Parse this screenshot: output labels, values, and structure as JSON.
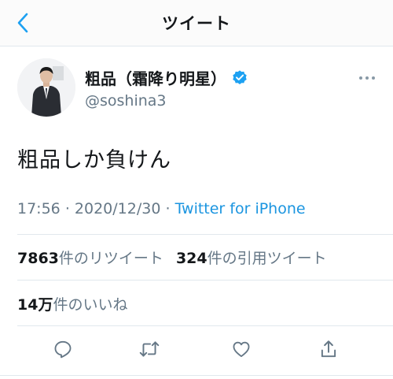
{
  "nav": {
    "title": "ツイート",
    "back_icon": "chevron-left-icon"
  },
  "user": {
    "name": "粗品（霜降り明星）",
    "handle": "@soshina3",
    "verified": true
  },
  "tweet": {
    "text": "粗品しか負けん",
    "time": "17:56",
    "date": "2020/12/30",
    "separator": "·",
    "source": "Twitter for iPhone"
  },
  "stats": {
    "retweets_count": "7863",
    "retweets_label": "件のリツイート",
    "quotes_count": "324",
    "quotes_label": "件の引用ツイート",
    "likes_count": "14万",
    "likes_label": "件のいいね"
  },
  "actions": [
    "reply-icon",
    "retweet-icon",
    "like-icon",
    "share-icon"
  ],
  "colors": {
    "link": "#1b95e0",
    "secondary": "#657786",
    "verified": "#1da1f2",
    "icon": "#657786"
  }
}
